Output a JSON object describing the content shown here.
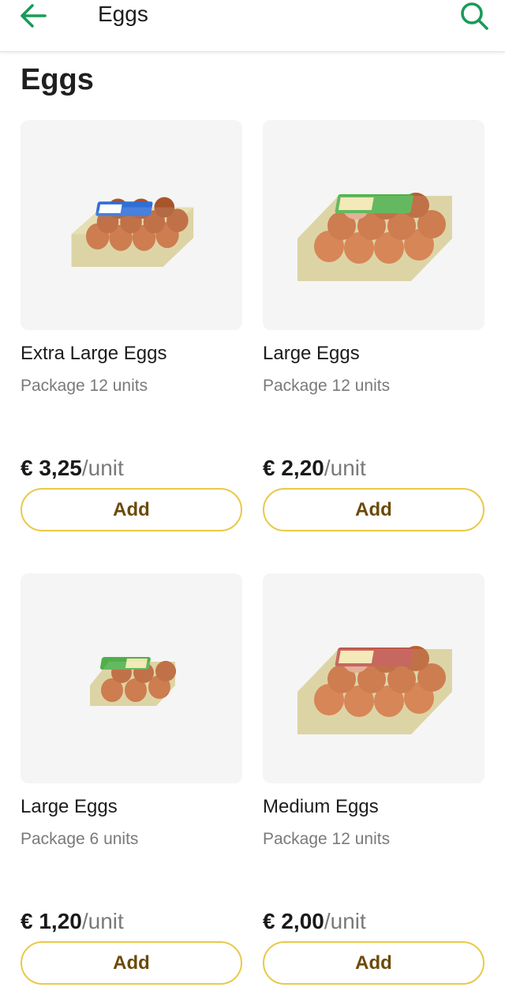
{
  "header": {
    "title": "Eggs",
    "back_icon": "arrow-left-icon",
    "search_icon": "search-icon",
    "accent_color": "#1a9a5a"
  },
  "page": {
    "title": "Eggs"
  },
  "products": [
    {
      "name": "Extra Large Eggs",
      "format": "Package 12 units",
      "price": "€ 3,25",
      "unit": "/unit",
      "add_label": "Add",
      "label_color": "#2f6fd6",
      "image": "egg-carton-12-image"
    },
    {
      "name": "Large Eggs",
      "format": "Package 12 units",
      "price": "€ 2,20",
      "unit": "/unit",
      "add_label": "Add",
      "label_color": "#4fb04a",
      "image": "egg-carton-12-image"
    },
    {
      "name": "Large Eggs",
      "format": "Package 6 units",
      "price": "€ 1,20",
      "unit": "/unit",
      "add_label": "Add",
      "label_color": "#4fb04a",
      "image": "egg-carton-6-image"
    },
    {
      "name": "Medium Eggs",
      "format": "Package 12 units",
      "price": "€ 2,00",
      "unit": "/unit",
      "add_label": "Add",
      "label_color": "#c0544a",
      "image": "egg-carton-12-image"
    }
  ],
  "colors": {
    "button_border": "#e8c94a",
    "button_text": "#6b4a0a",
    "card_background": "#f5f5f5"
  }
}
